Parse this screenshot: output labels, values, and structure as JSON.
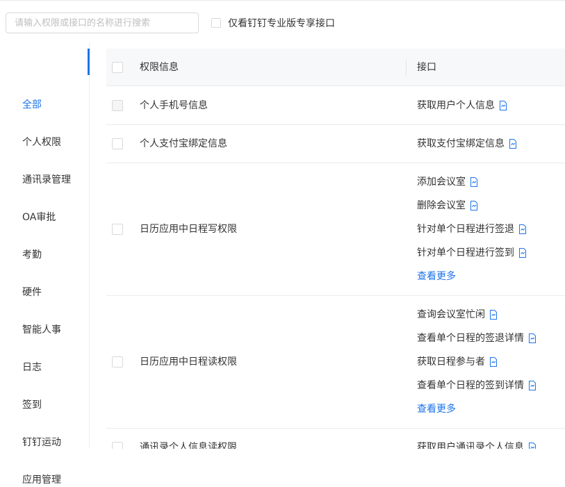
{
  "search": {
    "placeholder": "请输入权限或接口的名称进行搜索",
    "value": ""
  },
  "filter": {
    "label": "仅看钉钉专业版专享接口",
    "checked": false
  },
  "sidebar": {
    "items": [
      {
        "label": "全部",
        "active": true
      },
      {
        "label": "个人权限"
      },
      {
        "label": "通讯录管理"
      },
      {
        "label": "OA审批"
      },
      {
        "label": "考勤"
      },
      {
        "label": "硬件"
      },
      {
        "label": "智能人事"
      },
      {
        "label": "日志"
      },
      {
        "label": "签到"
      },
      {
        "label": "钉钉运动"
      },
      {
        "label": "应用管理"
      }
    ]
  },
  "table": {
    "headers": {
      "perm": "权限信息",
      "api": "接口"
    },
    "rows": [
      {
        "perm": "个人手机号信息",
        "checkbox_disabled": true,
        "apis": [
          "获取用户个人信息"
        ]
      },
      {
        "perm": "个人支付宝绑定信息",
        "apis": [
          "获取支付宝绑定信息"
        ]
      },
      {
        "perm": "日历应用中日程写权限",
        "apis": [
          "添加会议室",
          "删除会议室",
          "针对单个日程进行签退",
          "针对单个日程进行签到"
        ],
        "more": "查看更多"
      },
      {
        "perm": "日历应用中日程读权限",
        "apis": [
          "查询会议室忙闲",
          "查看单个日程的签退详情",
          "获取日程参与者",
          "查看单个日程的签到详情"
        ],
        "more": "查看更多"
      },
      {
        "perm": "通讯录个人信息读权限",
        "apis": [
          "获取用户通讯录个人信息"
        ]
      }
    ]
  },
  "colors": {
    "accent": "#1c73e8",
    "text": "#333333",
    "header_bg": "#f7f8fa",
    "border": "#ebebeb"
  },
  "icons": {
    "api_doc": "document-link-icon"
  }
}
